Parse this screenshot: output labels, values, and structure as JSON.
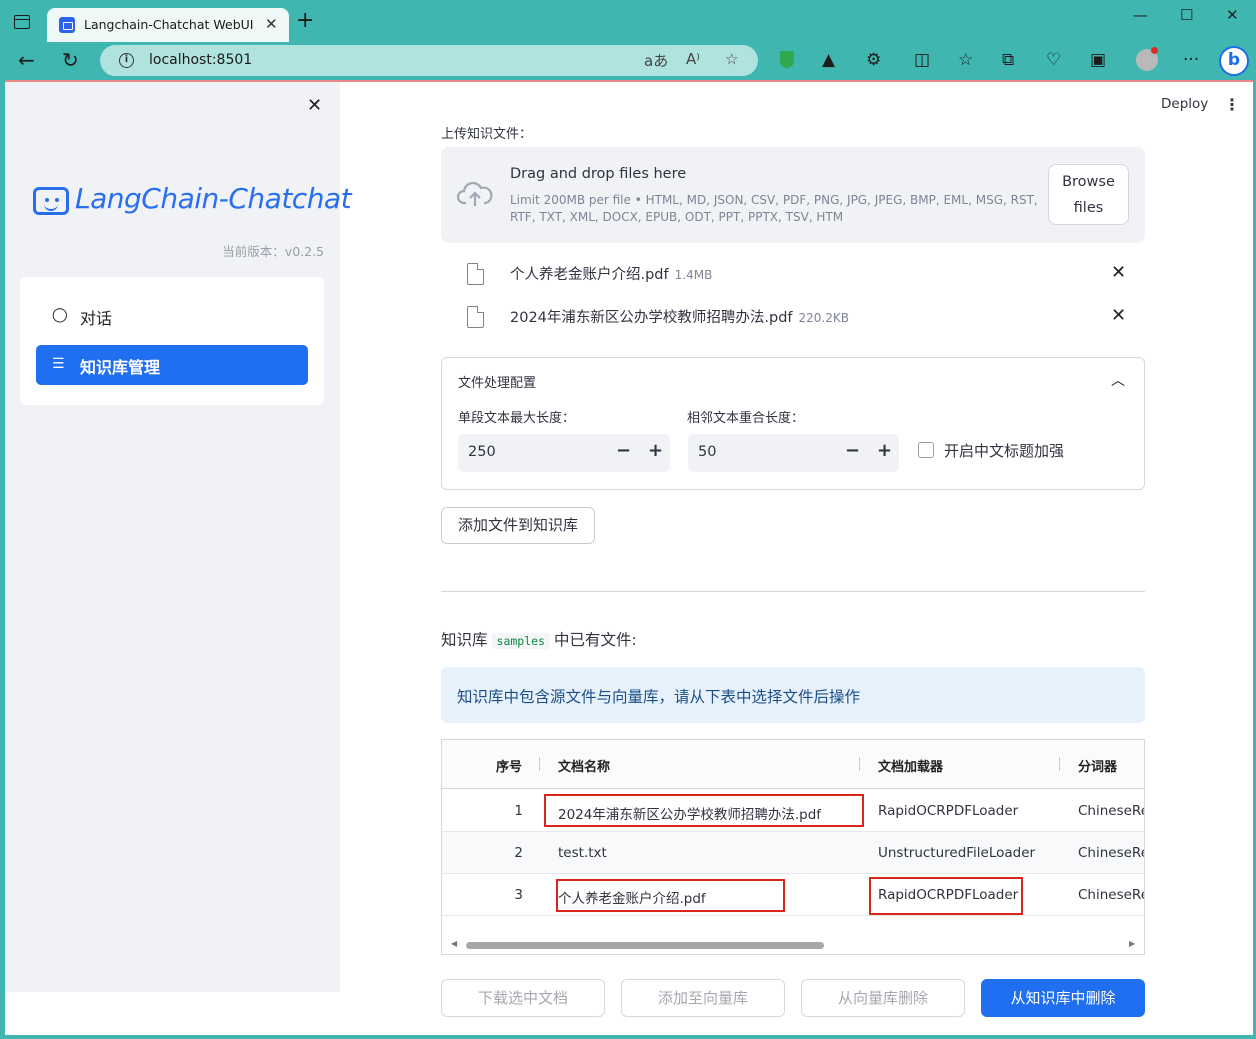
{
  "browser": {
    "tab_title": "Langchain-Chatchat WebUI",
    "tab_close": "✕",
    "new_tab": "+",
    "url": "localhost:8501",
    "win_min": "—",
    "win_max": "☐",
    "win_close": "✕"
  },
  "sidebar": {
    "close": "✕",
    "logo_text": "LangChain-Chatchat",
    "version": "当前版本：v0.2.5",
    "items": [
      {
        "label": "对话",
        "icon": "chat-bubble-icon",
        "active": false
      },
      {
        "label": "知识库管理",
        "icon": "database-icon",
        "active": true
      }
    ]
  },
  "header": {
    "deploy": "Deploy",
    "menu": "⋮"
  },
  "upload": {
    "label": "上传知识文件：",
    "dz_title": "Drag and drop files here",
    "dz_limit": "Limit 200MB per file • HTML, MD, JSON, CSV, PDF, PNG, JPG, JPEG, BMP, EML, MSG, RST, RTF, TXT, XML, DOCX, EPUB, ODT, PPT, PPTX, TSV, HTM",
    "browse": "Browse files",
    "files": [
      {
        "name": "个人养老金账户介绍.pdf",
        "size": "1.4MB"
      },
      {
        "name": "2024年浦东新区公办学校教师招聘办法.pdf",
        "size": "220.2KB"
      }
    ]
  },
  "config": {
    "title": "文件处理配置",
    "max_len_label": "单段文本最大长度：",
    "max_len_value": "250",
    "overlap_label": "相邻文本重合长度：",
    "overlap_value": "50",
    "chinese_title_label": "开启中文标题加强",
    "chinese_title_checked": false,
    "minus": "−",
    "plus": "+"
  },
  "add_button": "添加文件到知识库",
  "kb": {
    "prefix": "知识库",
    "name": "samples",
    "suffix": "中已有文件:",
    "info": "知识库中包含源文件与向量库，请从下表中选择文件后操作"
  },
  "table": {
    "headers": [
      "序号",
      "文档名称",
      "文档加载器",
      "分词器"
    ],
    "rows": [
      {
        "no": "1",
        "name": "2024年浦东新区公办学校教师招聘办法.pdf",
        "loader": "RapidOCRPDFLoader",
        "splitter": "ChineseRe"
      },
      {
        "no": "2",
        "name": "test.txt",
        "loader": "UnstructuredFileLoader",
        "splitter": "ChineseRe"
      },
      {
        "no": "3",
        "name": "个人养老金账户介绍.pdf",
        "loader": "RapidOCRPDFLoader",
        "splitter": "ChineseRe"
      }
    ]
  },
  "actions": {
    "download": "下载选中文档",
    "add_vector": "添加至向量库",
    "remove_vector": "从向量库删除",
    "delete_kb": "从知识库中删除"
  },
  "colors": {
    "accent": "#1f6ff0",
    "highlight": "#d9261c",
    "browser_chrome": "#3fb7b0"
  }
}
